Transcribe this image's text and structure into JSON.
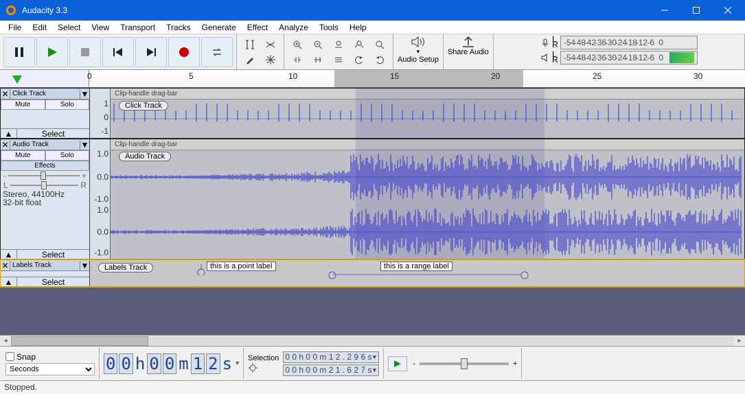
{
  "title": "Audacity 3.3",
  "menu": [
    "File",
    "Edit",
    "Select",
    "View",
    "Transport",
    "Tracks",
    "Generate",
    "Effect",
    "Analyze",
    "Tools",
    "Help"
  ],
  "toolbar": {
    "audio_setup": "Audio Setup",
    "share_audio": "Share Audio"
  },
  "meter_ticks": [
    "-54",
    "-48",
    "-42",
    "-36",
    "-30",
    "-24",
    "-18",
    "-12",
    "-6",
    "0"
  ],
  "meter_lr": {
    "l": "L",
    "r": "R"
  },
  "ruler_labels": [
    "0",
    "5",
    "10",
    "15",
    "20",
    "25",
    "30"
  ],
  "tracks": {
    "click": {
      "name": "Click Track",
      "clipbar": "Clip-handle drag-bar",
      "clipname": "Click Track",
      "mute": "Mute",
      "solo": "Solo",
      "select": "Select",
      "vscale": [
        "1",
        "0",
        "-1"
      ]
    },
    "audio": {
      "name": "Audio Track",
      "clipbar": "Clip-handle drag-bar",
      "clipname": "Audio Track",
      "mute": "Mute",
      "solo": "Solo",
      "select": "Select",
      "effects": "Effects",
      "info1": "Stereo, 44100Hz",
      "info2": "32-bit float",
      "vscale": [
        "1.0",
        "0.0",
        "-1.0"
      ],
      "gain_minus": "-",
      "gain_plus": "+",
      "pan_l": "L",
      "pan_r": "R"
    },
    "labels": {
      "name": "Labels Track",
      "clipname": "Labels Track",
      "select": "Select",
      "point_label": "this is a point label",
      "range_label": "this is a range label"
    }
  },
  "bottom": {
    "snap": "Snap",
    "snap_unit": "Seconds",
    "time_digits": [
      "0",
      "0",
      "0",
      "0",
      "1",
      "2"
    ],
    "time_units": [
      "h",
      "m",
      "s"
    ],
    "selection": "Selection",
    "sel_start": "0 0 h 0 0 m 1 2 . 2 9 6 s",
    "sel_end": "0 0 h 0 0 m 2 1 . 6 2 7 s",
    "slider_minus": "-",
    "slider_plus": "+"
  },
  "status": "Stopped."
}
